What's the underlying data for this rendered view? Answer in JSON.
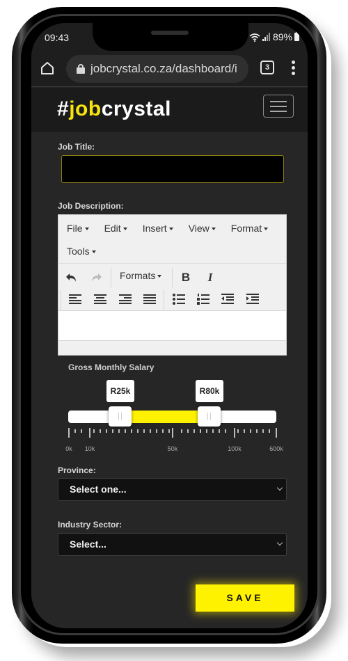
{
  "status_bar": {
    "time": "09:43",
    "battery": "89%",
    "icons": [
      "wifi-icon",
      "signal-icon",
      "battery-icon"
    ]
  },
  "browser": {
    "url": "jobcrystal.co.za/dashboard/i",
    "tab_count": "3",
    "icons": [
      "home-icon",
      "lock-icon",
      "tabs-icon",
      "more-vert-icon"
    ]
  },
  "site": {
    "logo_hash": "#",
    "logo_accent": "job",
    "logo_rest": "crystal",
    "brand_color": "#f7e30d",
    "menu_icon": "hamburger-icon"
  },
  "form": {
    "job_title_label": "Job Title:",
    "job_title_value": "",
    "job_description_label": "Job Description:",
    "editor": {
      "menus": [
        "File",
        "Edit",
        "Insert",
        "View",
        "Format",
        "Tools"
      ],
      "formats_label": "Formats",
      "toolbar_icons": [
        "undo-icon",
        "redo-icon",
        "bold-icon",
        "italic-icon",
        "align-left-icon",
        "align-center-icon",
        "align-right-icon",
        "align-justify-icon",
        "bullet-list-icon",
        "numbered-list-icon",
        "outdent-icon",
        "indent-icon"
      ],
      "content": ""
    },
    "salary": {
      "label": "Gross Monthly Salary",
      "min_value": "R25k",
      "max_value": "R80k",
      "tick_labels": [
        "0k",
        "10k",
        "50k",
        "100k",
        "600k"
      ],
      "fill_color": "#fff200"
    },
    "province_label": "Province:",
    "province_value": "Select one...",
    "industry_label": "Industry Sector:",
    "industry_value": "Select...",
    "save_label": "SAVE"
  }
}
